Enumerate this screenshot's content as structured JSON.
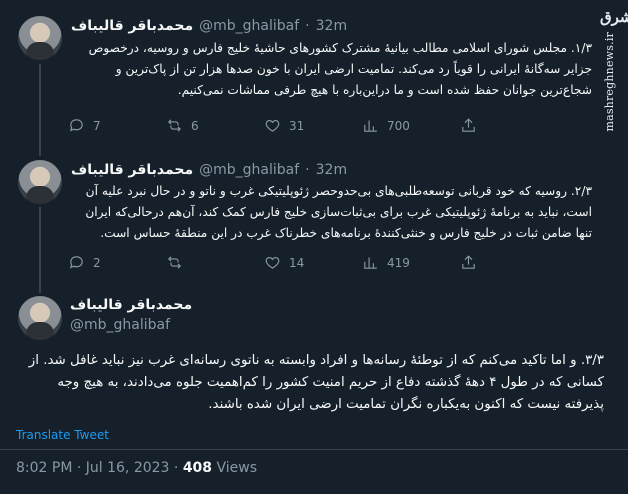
{
  "tweets": [
    {
      "display_name": "محمدباقر قالیباف",
      "handle": "@mb_ghalibaf",
      "dot": "·",
      "time": "32m",
      "text": "۱/۳. مجلس شورای اسلامی مطالب بیانیهٔ مشترک کشورهای حاشیهٔ خلیج فارس و روسیه، درخصوص جزایر سه‌گانهٔ ایرانی را قویاً رد می‌کند. تمامیت ارضی ایران با خون صدها هزار تن از پاک‌ترین و شجاع‌ترین جوانان حفظ شده است و ما دراین‌باره با هیچ طرفی مماشات نمی‌کنیم.",
      "replies": "7",
      "retweets": "6",
      "likes": "31",
      "views": "700"
    },
    {
      "display_name": "محمدباقر قالیباف",
      "handle": "@mb_ghalibaf",
      "dot": "·",
      "time": "32m",
      "text": "۲/۳. روسیه که خود قربانی توسعه‌طلبی‌های بی‌حدوحصر ژئوپلیتیکی غرب و ناتو و در حال نبرد علیه آن است، نباید به برنامهٔ ژئوپلیتیکی غرب برای بی‌ثبات‌سازی خلیج فارس کمک کند، آن‌هم درحالی‌که ایران تنها ضامن ثبات در خلیج فارس و خنثی‌کنندهٔ برنامه‌های خطرناک غرب در این منطقهٔ حساس است.",
      "replies": "2",
      "retweets": "",
      "likes": "14",
      "views": "419"
    }
  ],
  "main_tweet": {
    "display_name": "محمدباقر قالیباف",
    "handle": "@mb_ghalibaf",
    "text": "۳/۳. و اما تاکید می‌کنم که از توطئهٔ رسانه‌ها و افراد وابسته به ناتوی رسانه‌ای غرب نیز نباید غافل شد. از کسانی که در طول ۴ دههٔ گذشته دفاع از حریم امنیت کشور را کم‌اهمیت جلوه می‌دادند، به هیچ وجه پذیرفته نیست که اکنون به‌یکباره نگران تمامیت ارضی ایران شده باشند.",
    "translate": "Translate Tweet",
    "timestamp": "8:02 PM · Jul 16, 2023 ·",
    "views_count": "408",
    "views_label": "Views"
  },
  "watermark": {
    "logo": "مشرق",
    "site": "mashreghnews.ir"
  },
  "colors": {
    "background": "#15202b",
    "text": "#f7f9f9",
    "muted": "#8b98a5",
    "link": "#1d9bf0",
    "divider": "#38444d"
  }
}
